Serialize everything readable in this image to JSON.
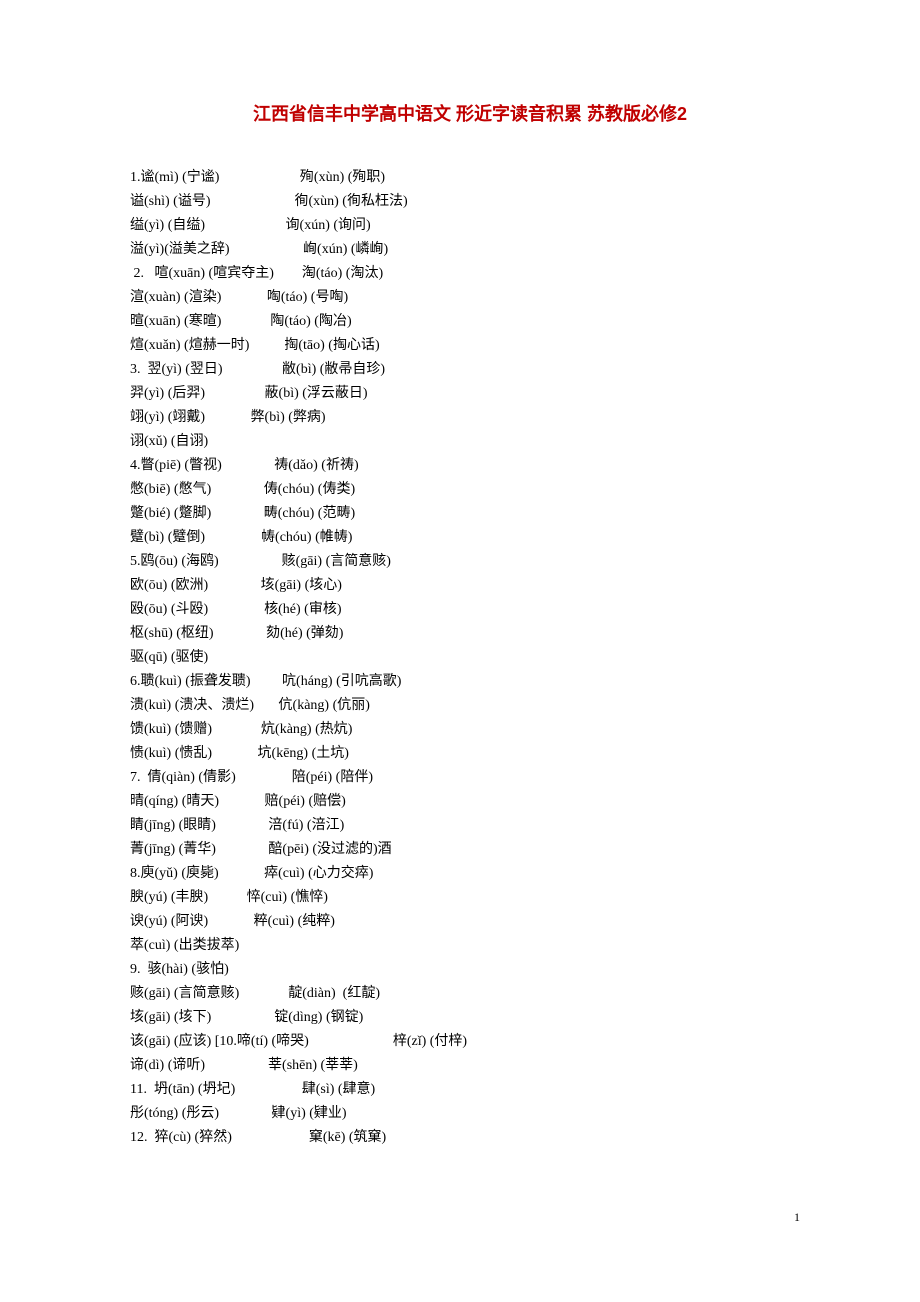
{
  "title": "江西省信丰中学高中语文 形近字读音积累 苏教版必修2",
  "lines": [
    "1.谧(mì) (宁谧)                       殉(xùn) (殉职)",
    "谥(shì) (谥号)                        徇(xùn) (徇私枉法)",
    "缢(yì) (自缢)                       询(xún) (询问)",
    "溢(yì)(溢美之辞)                     峋(xún) (嶙峋)",
    " 2.   喧(xuān) (喧宾夺主)        淘(táo) (淘汰)",
    "渲(xuàn) (渲染)             啕(táo) (号啕)",
    "暄(xuān) (寒暄)              陶(táo) (陶冶)",
    "煊(xuǎn) (煊赫一时)          掏(tāo) (掏心话)",
    "3.  翌(yì) (翌日)                 敝(bì) (敝帚自珍)",
    "羿(yì) (后羿)                 蔽(bì) (浮云蔽日)",
    "翊(yì) (翊戴)             弊(bì) (弊病)",
    "诩(xǔ) (自诩)",
    "4.瞥(piē) (瞥视)               祷(dǎo) (祈祷)",
    "憋(biē) (憋气)               俦(chóu) (俦类)",
    "蹩(bié) (蹩脚)               畴(chóu) (范畴)",
    "躄(bì) (躄倒)                帱(chóu) (帷帱)",
    "5.鸥(ōu) (海鸥)                  赅(gāi) (言简意赅)",
    "欧(ōu) (欧洲)               垓(gāi) (垓心)",
    "殴(ōu) (斗殴)                核(hé) (审核)",
    "枢(shū) (枢纽)               劾(hé) (弹劾)",
    "驱(qū) (驱使)",
    "6.聩(kuì) (振聋发聩)         吭(háng) (引吭高歌)",
    "溃(kuì) (溃决、溃烂)       伉(kàng) (伉丽)",
    "馈(kuì) (馈赠)              炕(kàng) (热炕)",
    "愦(kuì) (愦乱)             坑(kēng) (土坑)",
    "7.  倩(qiàn) (倩影)                陪(péi) (陪伴)",
    "晴(qíng) (晴天)             赔(péi) (赔偿)",
    "睛(jīng) (眼睛)               涪(fú) (涪江)",
    "菁(jīng) (菁华)               醅(pēi) (没过滤的)酒",
    "8.庾(yǔ) (庾毙)             瘁(cuì) (心力交瘁)",
    "腴(yú) (丰腴)           悴(cuì) (憔悴)",
    "谀(yú) (阿谀)             粹(cuì) (纯粹)",
    "萃(cuì) (出类拔萃)",
    "9.  骇(hài) (骇怕)",
    "赅(gāi) (言简意赅)              靛(diàn)  (红靛)",
    "垓(gāi) (垓下)                  锭(dìng) (钢锭)",
    "该(gāi) (应该) [10.啼(tí) (啼哭)                        梓(zǐ) (付梓)",
    "谛(dì) (谛听)                  莘(shēn) (莘莘)",
    "11.  坍(tān) (坍圮)                   肆(sì) (肆意)",
    "彤(tóng) (彤云)               肄(yì) (肄业)",
    "12.  猝(cù) (猝然)                      窠(kē) (筑窠)"
  ],
  "pagenum": "1"
}
